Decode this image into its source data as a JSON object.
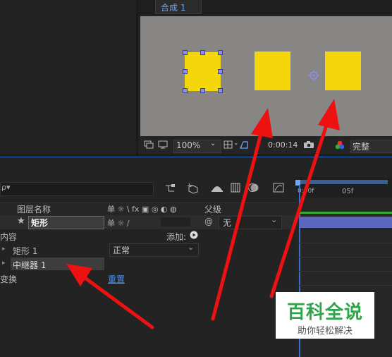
{
  "comp_tab": {
    "label": "合成 1"
  },
  "viewer_toolbar": {
    "zoom": "100%",
    "timecode": "0:00:14",
    "quality": "完整"
  },
  "timeline": {
    "search_placeholder": "ρ▾",
    "columns": {
      "layer_name": "图层名称",
      "switches": "单 ☼ \\ fx ▣ ◎ ◐ ◍",
      "parent": "父级"
    },
    "ruler": {
      "start": "0:00f",
      "mid": "05f"
    },
    "layer": {
      "name": "矩形",
      "parent": "无"
    },
    "rows": {
      "contents": "内容",
      "add_label": "添加:",
      "rect_item": "矩形 1",
      "blend_mode": "正常",
      "repeater_item": "中继器 1",
      "transform": "变换",
      "reset": "重置"
    }
  },
  "watermark": {
    "title": "百科全说",
    "subtitle": "助你轻松解决"
  },
  "colors": {
    "shape_fill": "#f5d60c",
    "accent_blue": "#6aa6ff",
    "arrow_red": "#ee1111",
    "watermark_green": "#2fa44a"
  }
}
